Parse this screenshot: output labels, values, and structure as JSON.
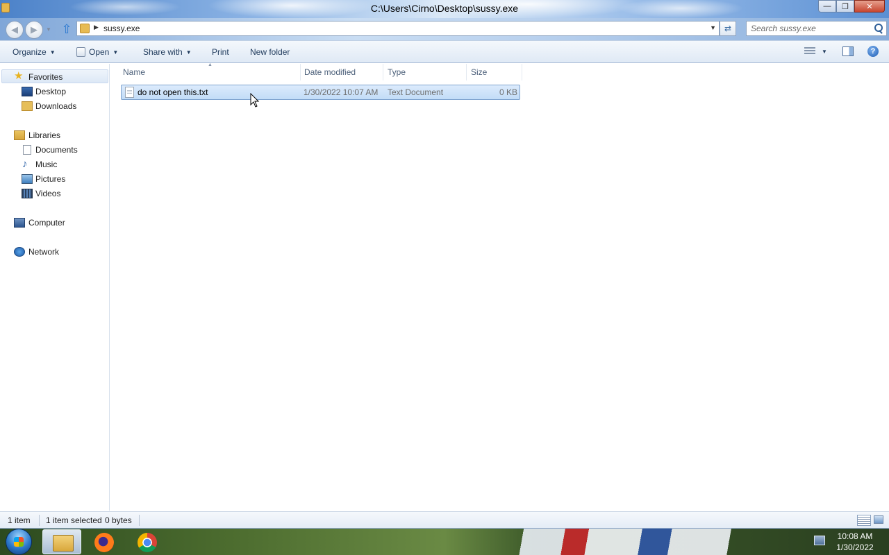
{
  "window": {
    "title": "C:\\Users\\Cirno\\Desktop\\sussy.exe",
    "minimize_icon": "minimize-icon",
    "restore_icon": "restore-icon",
    "close_icon": "close-icon"
  },
  "address": {
    "crumb": "sussy.exe",
    "search_placeholder": "Search sussy.exe"
  },
  "toolbar": {
    "organize": "Organize",
    "open": "Open",
    "share_with": "Share with",
    "print": "Print",
    "new_folder": "New folder"
  },
  "nav": {
    "favorites": "Favorites",
    "desktop": "Desktop",
    "downloads": "Downloads",
    "libraries": "Libraries",
    "documents": "Documents",
    "music": "Music",
    "pictures": "Pictures",
    "videos": "Videos",
    "computer": "Computer",
    "network": "Network"
  },
  "columns": {
    "name": "Name",
    "date_modified": "Date modified",
    "type": "Type",
    "size": "Size"
  },
  "files": [
    {
      "name": "do not open this.txt",
      "date_modified": "1/30/2022 10:07 AM",
      "type": "Text Document",
      "size": "0 KB",
      "selected": true
    }
  ],
  "status": {
    "item_count": "1 item",
    "selected": "1 item selected",
    "bytes": "0 bytes"
  },
  "taskbar": {
    "time": "10:08 AM",
    "date": "1/30/2022",
    "pinned": [
      "windows-explorer-icon",
      "firefox-icon",
      "chrome-icon"
    ]
  },
  "colors": {
    "selection": "#cfe3fa",
    "selection_border": "#7da2ce",
    "command_text": "#1e395b"
  }
}
